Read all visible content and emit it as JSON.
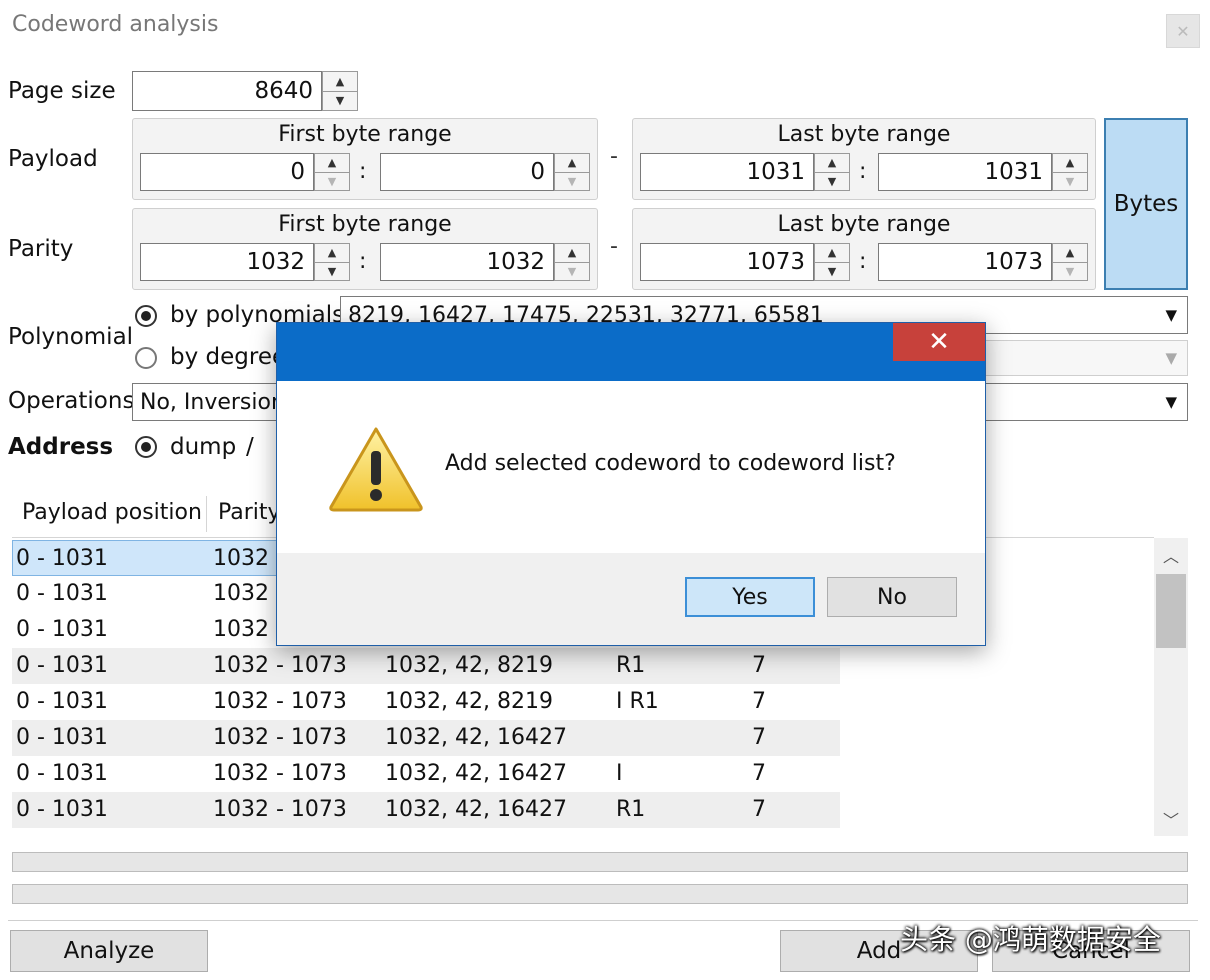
{
  "window": {
    "title": "Codeword analysis"
  },
  "page_size": {
    "label": "Page size",
    "value": "8640"
  },
  "payload": {
    "label": "Payload",
    "first_range": {
      "title": "First byte range",
      "from": "0",
      "to": "0"
    },
    "last_range": {
      "title": "Last byte range",
      "from": "1031",
      "to": "1031"
    }
  },
  "parity": {
    "label": "Parity",
    "first_range": {
      "title": "First byte range",
      "from": "1032",
      "to": "1032"
    },
    "last_range": {
      "title": "Last byte range",
      "from": "1073",
      "to": "1073"
    }
  },
  "separators": {
    "colon": ":",
    "dash": "-"
  },
  "bytes_button": "Bytes",
  "polynomial": {
    "label": "Polynomial",
    "option_polynomials": "by polynomials",
    "option_degree": "by degree",
    "polynomials_value": "8219, 16427, 17475, 22531, 32771, 65581"
  },
  "operations": {
    "label": "Operations",
    "value": "No, Inversion"
  },
  "address": {
    "label": "Address",
    "option_dump": "dump",
    "slash": "/"
  },
  "table": {
    "headers": [
      "Payload position",
      "Parity"
    ],
    "rows": [
      [
        "0 - 1031",
        "1032 -",
        "",
        "",
        ""
      ],
      [
        "0 - 1031",
        "1032 -",
        "",
        "",
        ""
      ],
      [
        "0 - 1031",
        "1032 -",
        "",
        "",
        ""
      ],
      [
        "0 - 1031",
        "1032 - 1073",
        "1032, 42, 8219",
        "R1",
        "7"
      ],
      [
        "0 - 1031",
        "1032 - 1073",
        "1032, 42, 8219",
        "I R1",
        "7"
      ],
      [
        "0 - 1031",
        "1032 - 1073",
        "1032, 42, 16427",
        "",
        "7"
      ],
      [
        "0 - 1031",
        "1032 - 1073",
        "1032, 42, 16427",
        "I",
        "7"
      ],
      [
        "0 - 1031",
        "1032 - 1073",
        "1032, 42, 16427",
        "R1",
        "7"
      ]
    ]
  },
  "buttons": {
    "analyze": "Analyze",
    "add": "Add",
    "cancel": "Cancel"
  },
  "dialog": {
    "message": "Add selected codeword to codeword list?",
    "yes": "Yes",
    "no": "No",
    "icon": "warning-icon"
  },
  "watermark": "头条 @鸿萌数据安全",
  "colors": {
    "dialog_title": "#0b6cc8",
    "dialog_close": "#c7413b",
    "selection": "#cfe6fa",
    "bytes_button": "#bcdcf4"
  }
}
